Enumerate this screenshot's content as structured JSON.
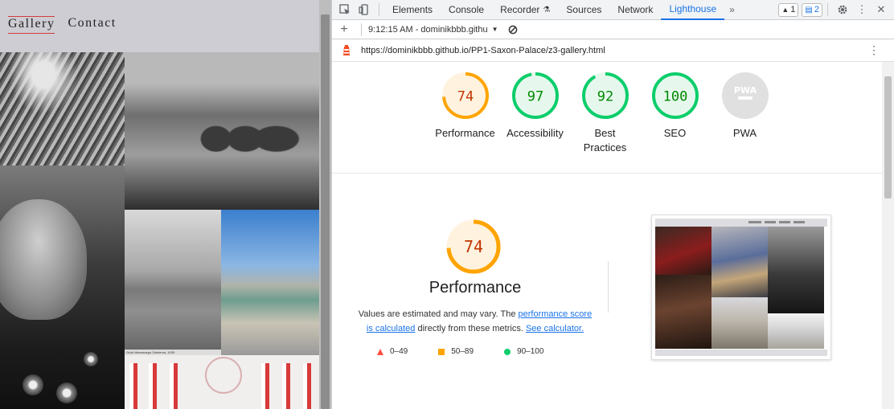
{
  "site_nav": {
    "gallery": "Gallery",
    "contact": "Contact"
  },
  "photos": {
    "caption": "Grób Nieznanego Żołnierza, 1939"
  },
  "devtools": {
    "tabs": [
      "Elements",
      "Console",
      "Recorder",
      "Sources",
      "Network",
      "Lighthouse"
    ],
    "active_tab": "Lighthouse",
    "more_tabs": "»",
    "warnings_count": "1",
    "messages_count": "2",
    "add_label": "+",
    "report_selector": "9:12:15 AM - dominikbbb.githu",
    "url": "https://dominikbbb.github.io/PP1-Saxon-Palace/z3-gallery.html"
  },
  "scores": [
    {
      "label": "Performance",
      "value": 74,
      "color": "#ffa400",
      "text_color": "#c33300",
      "bg": "#fff3e0"
    },
    {
      "label": "Accessibility",
      "value": 97,
      "color": "#0cce6b",
      "text_color": "#008800",
      "bg": "#e6f8ed"
    },
    {
      "label": "Best Practices",
      "value": 92,
      "color": "#0cce6b",
      "text_color": "#008800",
      "bg": "#e6f8ed"
    },
    {
      "label": "SEO",
      "value": 100,
      "color": "#0cce6b",
      "text_color": "#008800",
      "bg": "#e6f8ed"
    },
    {
      "label": "PWA",
      "value": null,
      "color": "#cccccc",
      "text_color": "#ffffff",
      "bg": "#e0e0e0"
    }
  ],
  "pwa_badge": "PWA",
  "performance": {
    "score": 74,
    "title": "Performance",
    "desc_prefix": "Values are estimated and may vary. The ",
    "desc_link1": "performance score is calculated",
    "desc_mid": " directly from these metrics. ",
    "desc_link2": "See calculator."
  },
  "legend": [
    {
      "shape": "triangle",
      "range": "0–49",
      "color": "#ff4e42"
    },
    {
      "shape": "square",
      "range": "50–89",
      "color": "#ffa400"
    },
    {
      "shape": "circle",
      "range": "90–100",
      "color": "#0cce6b"
    }
  ]
}
